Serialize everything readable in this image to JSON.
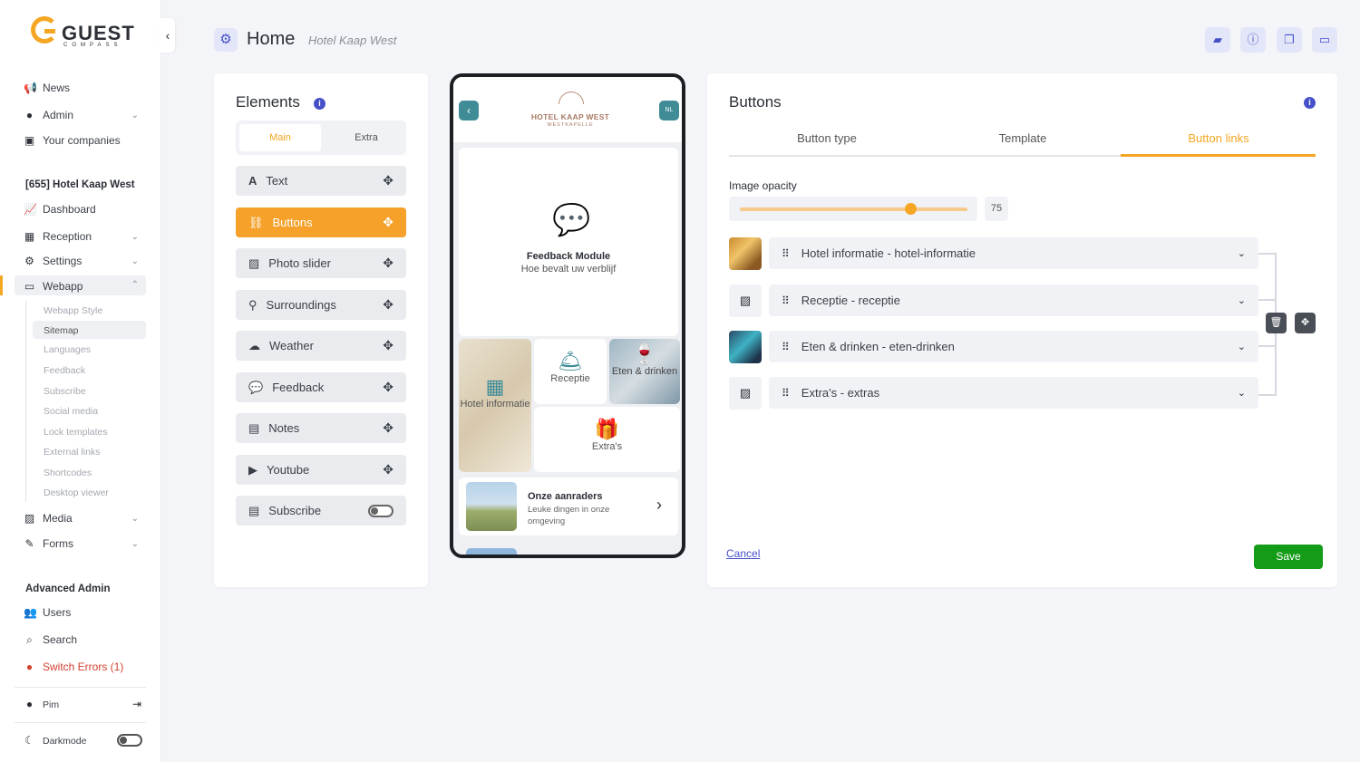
{
  "brand": {
    "name": "GUEST",
    "tagline": "COMPASS"
  },
  "sidebar": {
    "top_items": [
      {
        "label": "News",
        "icon": "megaphone-icon"
      },
      {
        "label": "Admin",
        "icon": "user-icon"
      },
      {
        "label": "Your companies",
        "icon": "building-icon"
      }
    ],
    "company_heading": "[655] Hotel Kaap West",
    "company_items": [
      {
        "label": "Dashboard",
        "icon": "chart-icon"
      },
      {
        "label": "Reception",
        "icon": "building-icon"
      },
      {
        "label": "Settings",
        "icon": "gear-icon"
      },
      {
        "label": "Webapp",
        "icon": "devices-icon"
      }
    ],
    "webapp_sub": [
      "Webapp Style",
      "Sitemap",
      "Languages",
      "Feedback",
      "Subscribe",
      "Social media",
      "Lock templates",
      "External links",
      "Shortcodes",
      "Desktop viewer"
    ],
    "more_items": [
      {
        "label": "Media",
        "icon": "image-icon"
      },
      {
        "label": "Forms",
        "icon": "form-icon"
      }
    ],
    "advanced_heading": "Advanced Admin",
    "advanced_items": [
      {
        "label": "Users",
        "icon": "users-icon"
      },
      {
        "label": "Search",
        "icon": "search-icon"
      }
    ],
    "errors_label": "Switch Errors (1)",
    "user_name": "Pim",
    "darkmode_label": "Darkmode"
  },
  "header": {
    "title": "Home",
    "subtitle": "Hotel Kaap West"
  },
  "elements_panel": {
    "title": "Elements",
    "tabs": {
      "main": "Main",
      "extra": "Extra"
    },
    "items": [
      {
        "label": "Text",
        "icon": "text-icon"
      },
      {
        "label": "Buttons",
        "icon": "link-icon"
      },
      {
        "label": "Photo slider",
        "icon": "images-icon"
      },
      {
        "label": "Surroundings",
        "icon": "pin-icon"
      },
      {
        "label": "Weather",
        "icon": "cloud-sun-icon"
      },
      {
        "label": "Feedback",
        "icon": "comments-icon"
      },
      {
        "label": "Notes",
        "icon": "note-icon"
      },
      {
        "label": "Youtube",
        "icon": "youtube-icon"
      },
      {
        "label": "Subscribe",
        "icon": "newsletter-icon"
      }
    ]
  },
  "phone": {
    "lang": "NL",
    "logo_main": "HOTEL KAAP WEST",
    "logo_sub": "WESTKAPELLE",
    "feedback_title": "Feedback Module",
    "feedback_sub": "Hoe bevalt uw verblijf",
    "tiles": {
      "hotel": "Hotel informatie",
      "receptie": "Receptie",
      "eten": "Eten & drinken",
      "extras": "Extra's"
    },
    "card_title": "Onze aanraders",
    "card_sub": "Leuke dingen in onze omgeving"
  },
  "buttons_panel": {
    "title": "Buttons",
    "tabs": [
      "Button type",
      "Template",
      "Button links"
    ],
    "active_tab": "Button links",
    "opacity_label": "Image opacity",
    "opacity_value": "75",
    "opacity_fraction": 0.75,
    "links": [
      {
        "label": "Hotel informatie - hotel-informatie",
        "thumb": "photo"
      },
      {
        "label": "Receptie - receptie",
        "thumb": "placeholder"
      },
      {
        "label": "Eten & drinken - eten-drinken",
        "thumb": "photo"
      },
      {
        "label": "Extra's - extras",
        "thumb": "placeholder"
      }
    ],
    "cancel_label": "Cancel",
    "save_label": "Save"
  },
  "colors": {
    "accent": "#f5a623",
    "primary": "#4651c9",
    "save": "#149b17",
    "teal": "#3f8c97"
  }
}
